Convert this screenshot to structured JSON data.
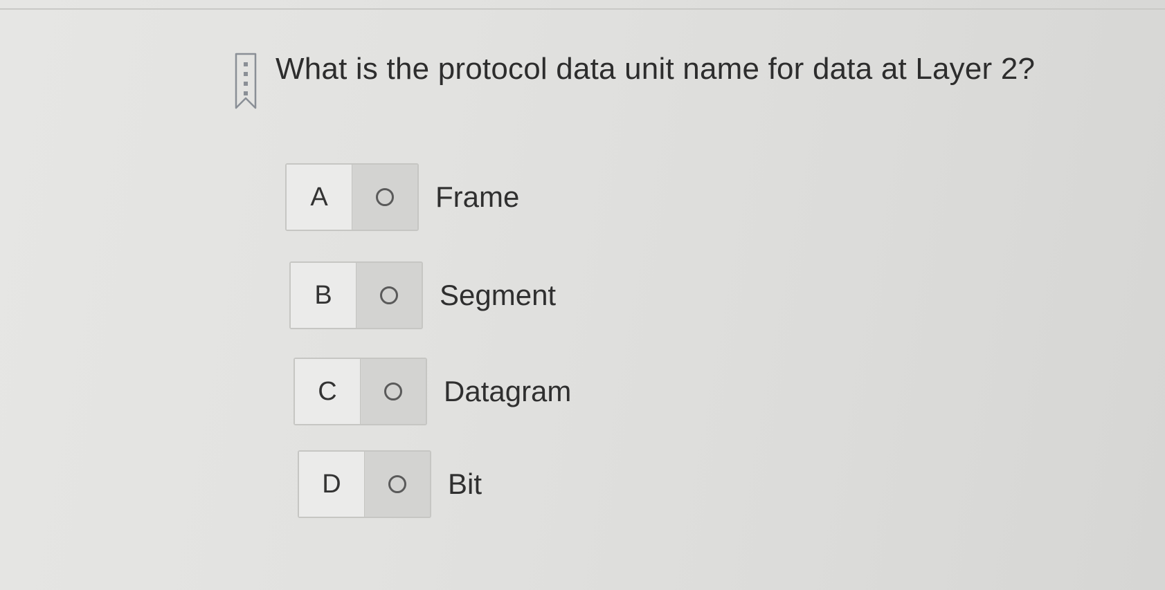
{
  "question": {
    "text": "What is the protocol data unit name for data at Layer 2?",
    "icon": "bookmark-icon"
  },
  "options": [
    {
      "letter": "A",
      "label": "Frame",
      "selected": false
    },
    {
      "letter": "B",
      "label": "Segment",
      "selected": false
    },
    {
      "letter": "C",
      "label": "Datagram",
      "selected": false
    },
    {
      "letter": "D",
      "label": "Bit",
      "selected": false
    }
  ],
  "colors": {
    "background": "#e2e2e0",
    "radio_cell": "#d3d3d1",
    "text": "#2f2f2f"
  }
}
